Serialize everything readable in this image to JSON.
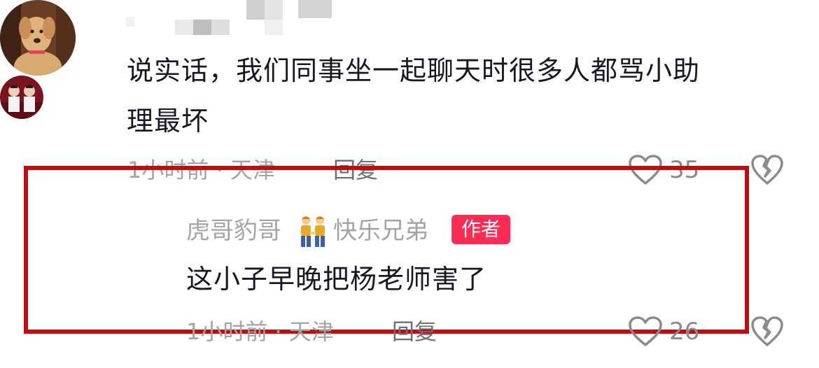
{
  "comment": {
    "text_line1": "说实话，我们同事坐一起聊天时很多人都骂小助",
    "text_line2": "理最坏",
    "time": "1小时前",
    "separator": "·",
    "location": "天津",
    "reply_label": "回复",
    "like_count": "35"
  },
  "reply": {
    "username": "虎哥豹哥",
    "username_suffix": "快乐兄弟",
    "author_badge": "作者",
    "text": "这小子早晚把杨老师害了",
    "time": "1小时前",
    "separator": "·",
    "location": "天津",
    "reply_label": "回复",
    "like_count": "26"
  },
  "colors": {
    "accent_badge": "#fe2c55",
    "highlight_border": "#c00d0d",
    "primary_text": "#161823",
    "secondary_text": "#a3a4a8"
  },
  "icons": [
    "heart-outline-icon",
    "broken-heart-icon",
    "couple-emoji-icon"
  ]
}
